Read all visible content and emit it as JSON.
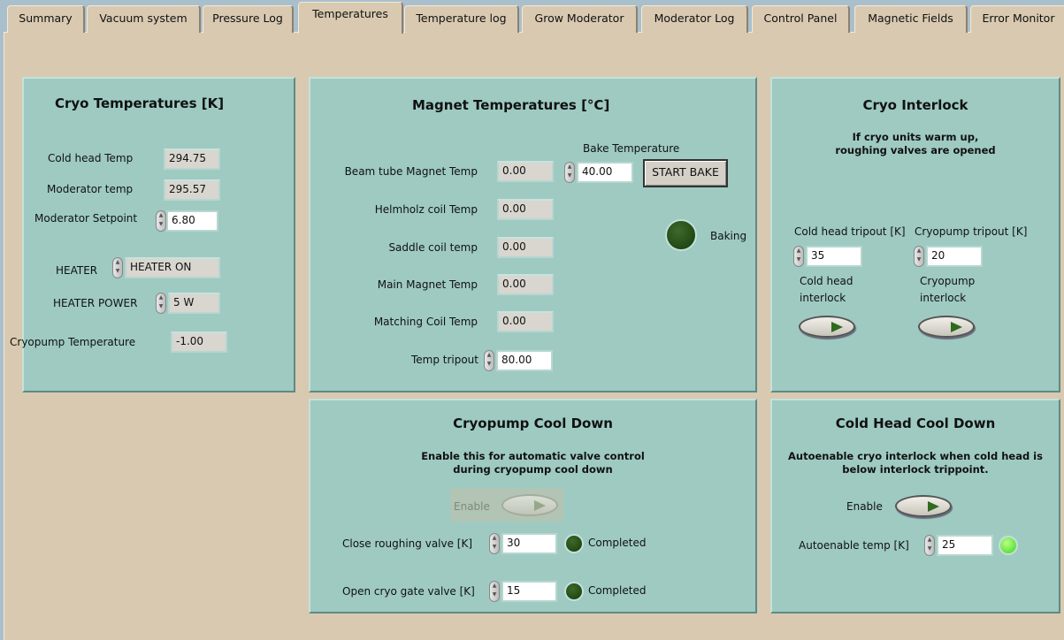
{
  "tabs": [
    "Summary",
    "Vacuum system",
    "Pressure Log",
    "Temperatures",
    "Temperature log",
    "Grow Moderator",
    "Moderator Log",
    "Control Panel",
    "Magnetic Fields",
    "Error Monitor"
  ],
  "active_tab": "Temperatures",
  "cryo": {
    "title": "Cryo Temperatures [K]",
    "cold_head_label": "Cold head Temp",
    "cold_head_value": "294.75",
    "moderator_label": "Moderator temp",
    "moderator_value": "295.57",
    "setpoint_label": "Moderator Setpoint",
    "setpoint_value": "6.80",
    "heater_label": "HEATER",
    "heater_value": "HEATER ON",
    "heater_power_label": "HEATER POWER",
    "heater_power_value": "5 W",
    "cryopump_label": "Cryopump Temperature",
    "cryopump_value": "-1.00"
  },
  "magnet": {
    "title": "Magnet Temperatures [°C]",
    "rows": [
      {
        "label": "Beam tube Magnet Temp",
        "value": "0.00"
      },
      {
        "label": "Helmholz coil Temp",
        "value": "0.00"
      },
      {
        "label": "Saddle coil temp",
        "value": "0.00"
      },
      {
        "label": "Main Magnet Temp",
        "value": "0.00"
      },
      {
        "label": "Matching Coil Temp",
        "value": "0.00"
      }
    ],
    "tripout_label": "Temp tripout",
    "tripout_value": "80.00",
    "bake_label": "Bake Temperature",
    "bake_value": "40.00",
    "start_bake": "START BAKE",
    "baking_label": "Baking"
  },
  "interlock": {
    "title": "Cryo Interlock",
    "note1": "If cryo units warm up,",
    "note2": "roughing valves are opened",
    "cold_tripout_label": "Cold head tripout [K]",
    "cold_tripout_value": "35",
    "cryo_tripout_label": "Cryopump tripout [K]",
    "cryo_tripout_value": "20",
    "cold_interlock_1": "Cold head",
    "cold_interlock_2": "interlock",
    "cryo_interlock_1": "Cryopump",
    "cryo_interlock_2": "interlock"
  },
  "cooldown": {
    "title": "Cryopump Cool Down",
    "note1": "Enable this for automatic valve control",
    "note2": "during cryopump cool down",
    "enable_label": "Enable",
    "rough_label": "Close roughing valve [K]",
    "rough_value": "30",
    "rough_status": "Completed",
    "gate_label": "Open cryo gate valve [K]",
    "gate_value": "15",
    "gate_status": "Completed"
  },
  "coldhead": {
    "title": "Cold Head Cool Down",
    "note1": "Autoenable cryo interlock when cold head is",
    "note2": "below interlock trippoint.",
    "enable_label": "Enable",
    "auto_label": "Autoenable temp [K]",
    "auto_value": "25"
  }
}
